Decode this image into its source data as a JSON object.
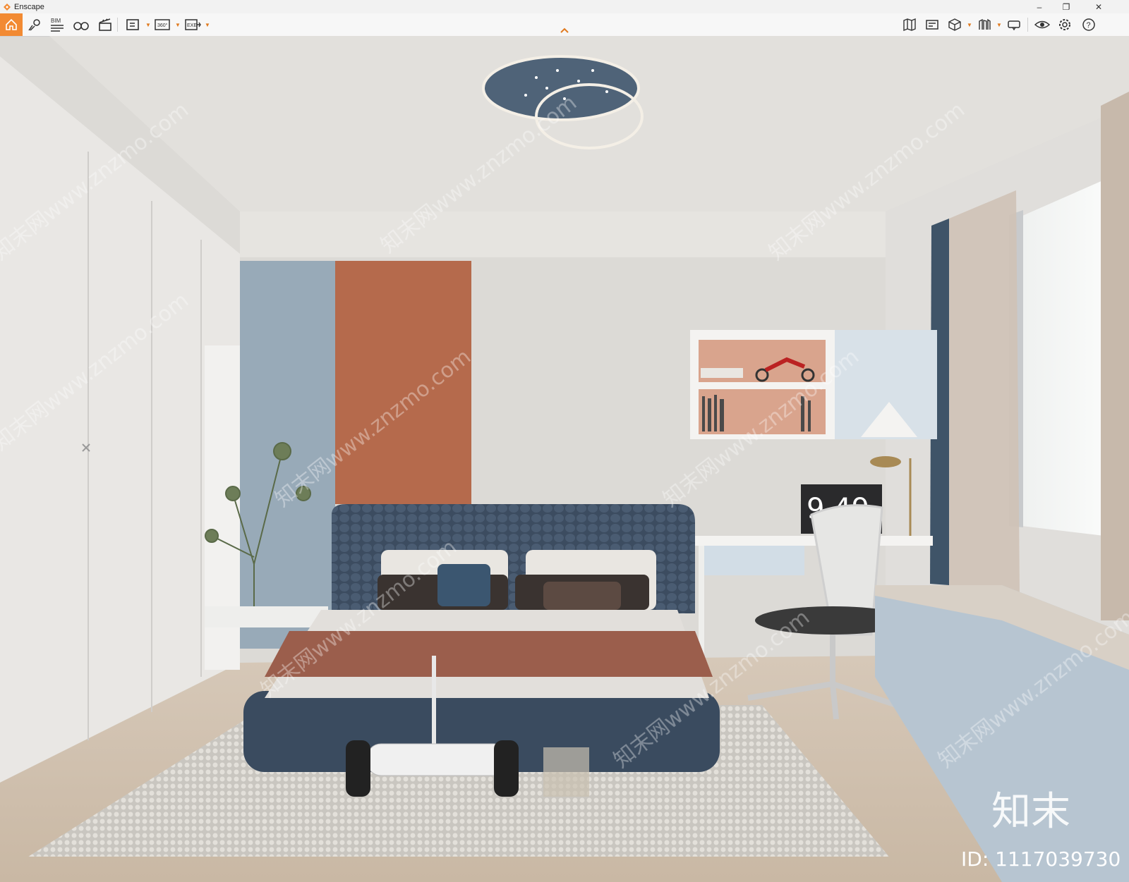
{
  "window": {
    "title": "Enscape",
    "minimize_glyph": "–",
    "restore_glyph": "❐",
    "close_glyph": "✕"
  },
  "toolbar": {
    "left_items": [
      "home-icon",
      "map-pin-icon",
      "bim-icon",
      "binoculars-icon",
      "clapboard-icon",
      "screenshot-export-icon",
      "panorama-360-icon",
      "exe-export-icon"
    ],
    "bim_text": "BIM",
    "pano_text": "360°",
    "exe_text": "EXE",
    "right_items": [
      "map-view-icon",
      "video-editor-icon",
      "asset-cube-icon",
      "library-icon",
      "vr-headset-icon",
      "visual-settings-icon",
      "settings-gear-icon",
      "help-icon"
    ],
    "help_glyph": "?",
    "accent": "#f28a33"
  },
  "viewport": {
    "watermark_text": "知末网www.znzmo.com",
    "brand_text": "知末",
    "id_text": "ID: 1117039730",
    "clock_text": "9 49"
  }
}
